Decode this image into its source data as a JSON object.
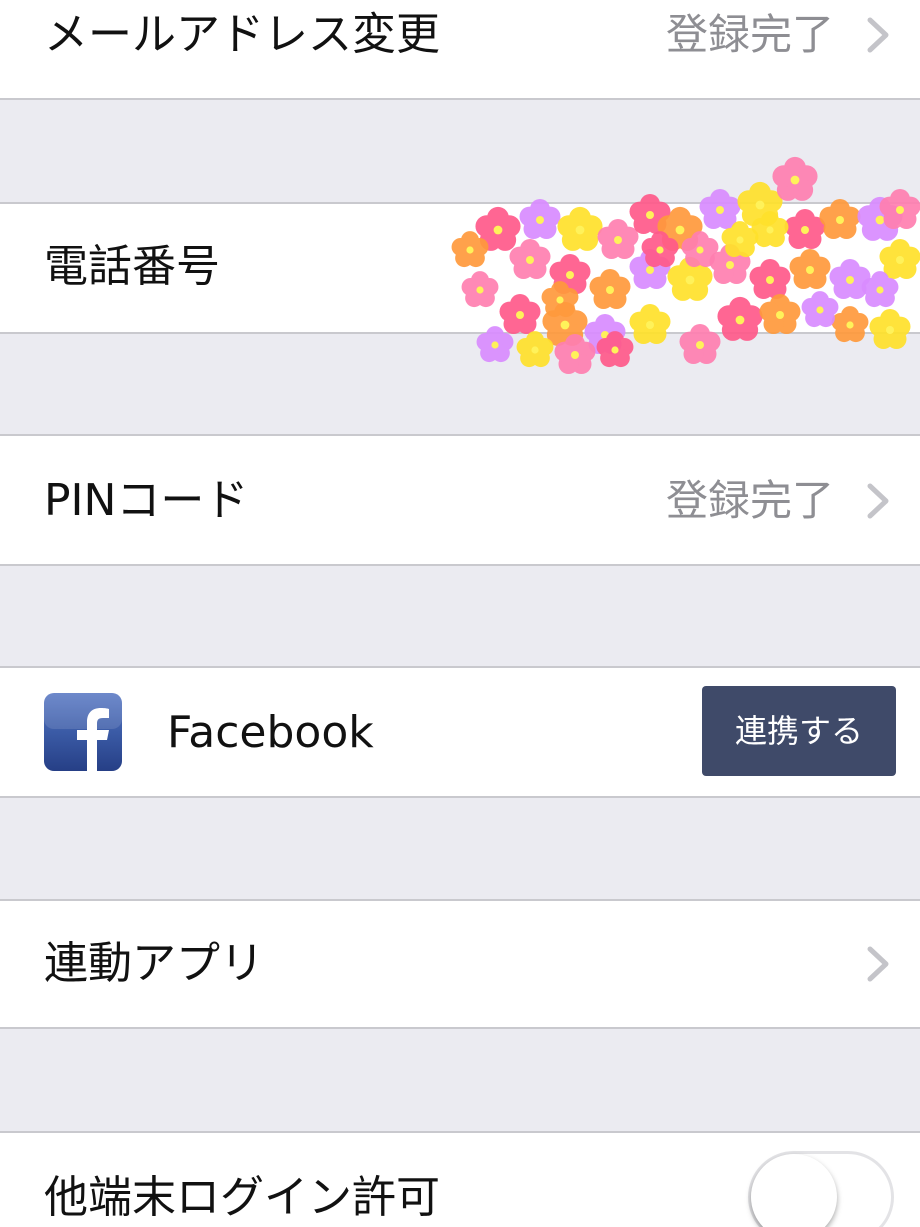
{
  "settings": {
    "email": {
      "label": "メールアドレス変更",
      "status": "登録完了"
    },
    "phone": {
      "label": "電話番号"
    },
    "pin": {
      "label": "PINコード",
      "status": "登録完了"
    },
    "facebook": {
      "label": "Facebook",
      "button_label": "連携する",
      "icon": "facebook-logo",
      "button_color": "#3f4a69"
    },
    "linked_apps": {
      "label": "連動アプリ"
    },
    "other_device_login": {
      "label": "他端末ログイン許可",
      "toggle_on": false
    }
  },
  "overlay": {
    "icon": "flower-sticker-cluster",
    "colors": [
      "#ff5a8a",
      "#ff9a3c",
      "#d98cff",
      "#ffe12b",
      "#ff7fb0"
    ]
  }
}
